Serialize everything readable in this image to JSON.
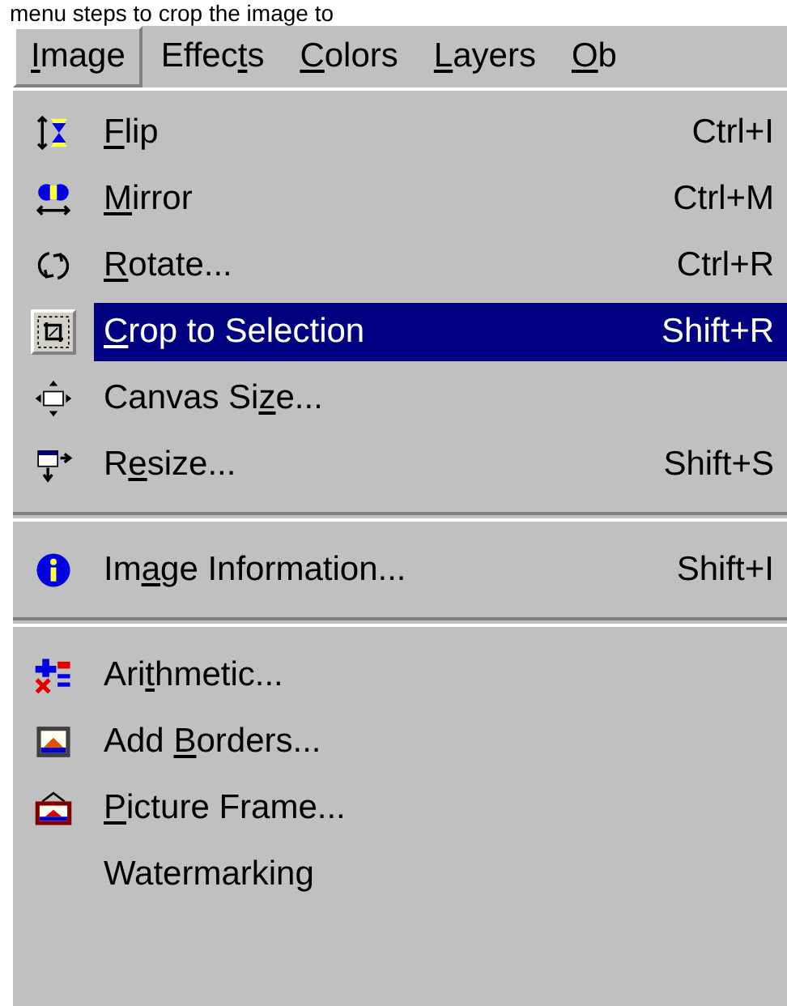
{
  "page_text": "menu steps to crop the image to",
  "menubar": [
    {
      "key": "I",
      "post": "mage",
      "selected": true
    },
    {
      "pre": "Effec",
      "key": "t",
      "post": "s",
      "selected": false
    },
    {
      "key": "C",
      "post": "olors",
      "selected": false
    },
    {
      "key": "L",
      "post": "ayers",
      "selected": false
    },
    {
      "key": "O",
      "post": "b",
      "selected": false
    }
  ],
  "menu": [
    {
      "kind": "flip",
      "key": "F",
      "post": "lip",
      "shortcut": "Ctrl+I",
      "selected": false
    },
    {
      "kind": "mirror",
      "key": "M",
      "post": "irror",
      "shortcut": "Ctrl+M",
      "selected": false
    },
    {
      "kind": "rotate",
      "key": "R",
      "post": "otate...",
      "shortcut": "Ctrl+R",
      "selected": false
    },
    {
      "kind": "crop",
      "key": "C",
      "post": "rop to Selection",
      "shortcut": "Shift+R",
      "selected": true
    },
    {
      "kind": "canvas",
      "pre": "Canvas Si",
      "key": "z",
      "post": "e...",
      "selected": false
    },
    {
      "kind": "resize",
      "pre": "R",
      "key": "e",
      "post": "size...",
      "shortcut": "Shift+S",
      "selected": false
    },
    {
      "kind": "separator"
    },
    {
      "kind": "info",
      "pre": "Im",
      "key": "a",
      "post": "ge Information...",
      "shortcut": "Shift+I",
      "selected": false
    },
    {
      "kind": "separator"
    },
    {
      "kind": "arithmetic",
      "pre": "Ari",
      "key": "t",
      "post": "hmetic...",
      "selected": false
    },
    {
      "kind": "borders",
      "pre": "Add ",
      "key": "B",
      "post": "orders...",
      "selected": false
    },
    {
      "kind": "frame",
      "key": "P",
      "post": "icture Frame...",
      "selected": false
    },
    {
      "kind": "plain",
      "pre": "Watermarking",
      "selected": false
    }
  ]
}
